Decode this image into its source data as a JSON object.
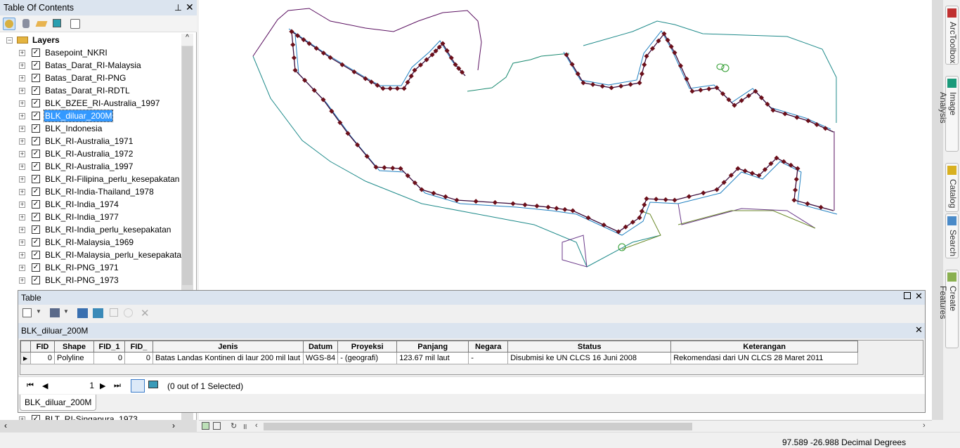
{
  "toc": {
    "title": "Table Of Contents",
    "pin_icon": "pin-icon",
    "close_icon": "close-icon",
    "root": "Layers",
    "layers": [
      {
        "name": "Basepoint_NKRI",
        "checked": true
      },
      {
        "name": "Batas_Darat_RI-Malaysia",
        "checked": true
      },
      {
        "name": "Batas_Darat_RI-PNG",
        "checked": true
      },
      {
        "name": "Batas_Darat_RI-RDTL",
        "checked": true
      },
      {
        "name": "BLK_BZEE_RI-Australia_1997",
        "checked": true
      },
      {
        "name": "BLK_diluar_200M",
        "checked": true,
        "selected": true
      },
      {
        "name": "BLK_Indonesia",
        "checked": true
      },
      {
        "name": "BLK_RI-Australia_1971",
        "checked": true
      },
      {
        "name": "BLK_RI-Australia_1972",
        "checked": true
      },
      {
        "name": "BLK_RI-Australia_1997",
        "checked": true
      },
      {
        "name": "BLK_RI-Filipina_perlu_kesepakatan",
        "checked": true
      },
      {
        "name": "BLK_RI-India-Thailand_1978",
        "checked": true
      },
      {
        "name": "BLK_RI-India_1974",
        "checked": true
      },
      {
        "name": "BLK_RI-India_1977",
        "checked": true
      },
      {
        "name": "BLK_RI-India_perlu_kesepakatan",
        "checked": true
      },
      {
        "name": "BLK_RI-Malaysia_1969",
        "checked": true
      },
      {
        "name": "BLK_RI-Malaysia_perlu_kesepakatan",
        "checked": true
      },
      {
        "name": "BLK_RI-PNG_1971",
        "checked": true
      },
      {
        "name": "BLK_RI-PNG_1973",
        "checked": true
      }
    ],
    "last_visible": "BLT_RI-Singapura_1973"
  },
  "table": {
    "title": "Table",
    "layer": "BLK_diluar_200M",
    "columns": [
      "FID",
      "Shape",
      "FID_1",
      "FID_",
      "Jenis",
      "Datum",
      "Proyeksi",
      "Panjang",
      "Negara",
      "Status",
      "Keterangan"
    ],
    "rows": [
      [
        "0",
        "Polyline",
        "0",
        "0",
        "Batas Landas Kontinen di laur 200 mil laut",
        "WGS-84",
        "- (geografi)",
        "123.67 mil laut",
        "-",
        "Disubmisi ke UN CLCS 16 Juni 2008",
        "Rekomendasi dari UN CLCS 28 Maret 2011"
      ]
    ],
    "record": "1",
    "selection": "(0 out of 1 Selected)",
    "tab": "BLK_diluar_200M"
  },
  "dock": [
    "ArcToolbox",
    "Image Analysis",
    "Catalog",
    "Search",
    "Create Features"
  ],
  "status": {
    "coords": "97.589  -26.988 Decimal Degrees"
  },
  "colors": {
    "boundary": "#3a0a3a",
    "offset": "#1e7fc0",
    "vertex": "#6b0f1a",
    "coast": "#1e8a8a",
    "selection": "#3399ff"
  }
}
